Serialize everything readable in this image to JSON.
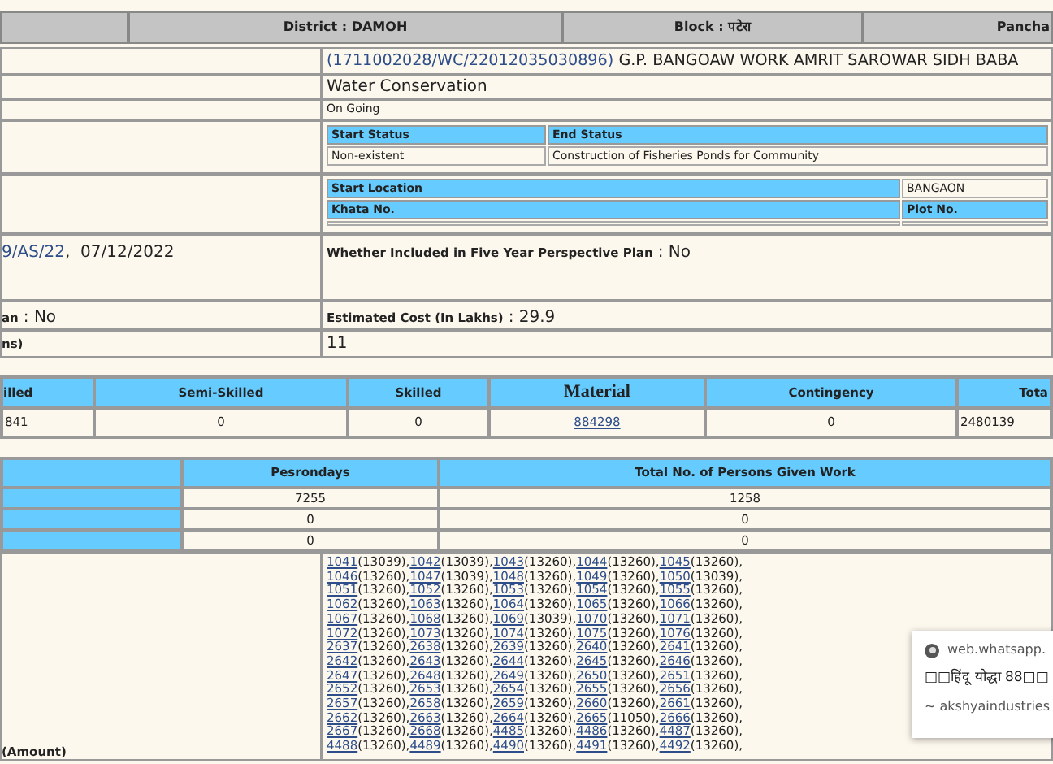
{
  "header": {
    "district": "District : DAMOH",
    "block": "Block : पटेरा",
    "panchayat": "Pancha"
  },
  "work": {
    "code": "(1711002028/WC/22012035030896)",
    "name": "G.P. BANGOAW WORK AMRIT SAROWAR SIDH BABA",
    "category": "Water Conservation",
    "status": "On Going"
  },
  "status_table": {
    "columns": [
      "Start Status",
      "End Status"
    ],
    "row": [
      "Non-existent",
      "Construction of Fisheries Ponds for Community"
    ]
  },
  "location_table": {
    "rows": [
      [
        {
          "text": "Start Location",
          "kind": "header"
        },
        {
          "text": "BANGAON",
          "kind": "cell"
        }
      ],
      [
        {
          "text": "Khata No.",
          "kind": "header"
        },
        {
          "text": "Plot No.",
          "kind": "header"
        }
      ]
    ]
  },
  "sanction": {
    "order": "9/AS/22",
    "date": ",  07/12/2022"
  },
  "perspective_plan": {
    "label": "Whether Included in Five Year Perspective Plan",
    "value": ": No"
  },
  "plan_field": {
    "label": "an",
    "value": ": No"
  },
  "estimated_cost": {
    "label": "Estimated Cost (In Lakhs)",
    "value": ": 29.9"
  },
  "count_field": {
    "label": "ns)",
    "value": "11"
  },
  "cost_table": {
    "columns": [
      {
        "label": "illed",
        "kind": "plain"
      },
      {
        "label": "Semi-Skilled",
        "kind": "plain"
      },
      {
        "label": "Skilled",
        "kind": "plain"
      },
      {
        "label": "Material",
        "kind": "large"
      },
      {
        "label": "Contingency",
        "kind": "plain"
      },
      {
        "label": "Tota",
        "kind": "plain"
      }
    ],
    "row": [
      {
        "text": "841",
        "kind": "text"
      },
      {
        "text": "0",
        "kind": "number"
      },
      {
        "text": "0",
        "kind": "number"
      },
      {
        "text": "884298",
        "kind": "link"
      },
      {
        "text": "0",
        "kind": "number"
      },
      {
        "text": "2480139",
        "kind": "text"
      }
    ]
  },
  "persondays_table": {
    "columns": [
      "Pesrondays",
      "Total No. of Persons Given Work"
    ],
    "rows": [
      [
        "7255",
        "1258"
      ],
      [
        "0",
        "0"
      ],
      [
        "0",
        "0"
      ]
    ]
  },
  "amount": {
    "label": "(Amount)",
    "work_codes": [
      [
        [
          "1041",
          "(13039),"
        ],
        [
          "1042",
          "(13039),"
        ],
        [
          "1043",
          "(13260),"
        ],
        [
          "1044",
          "(13260),"
        ],
        [
          "1045",
          "(13260),"
        ]
      ],
      [
        [
          "1046",
          "(13260),"
        ],
        [
          "1047",
          "(13039),"
        ],
        [
          "1048",
          "(13260),"
        ],
        [
          "1049",
          "(13260),"
        ],
        [
          "1050",
          "(13039),"
        ]
      ],
      [
        [
          "1051",
          "(13260),"
        ],
        [
          "1052",
          "(13260),"
        ],
        [
          "1053",
          "(13260),"
        ],
        [
          "1054",
          "(13260),"
        ],
        [
          "1055",
          "(13260),"
        ]
      ],
      [
        [
          "1062",
          "(13260),"
        ],
        [
          "1063",
          "(13260),"
        ],
        [
          "1064",
          "(13260),"
        ],
        [
          "1065",
          "(13260),"
        ],
        [
          "1066",
          "(13260),"
        ]
      ],
      [
        [
          "1067",
          "(13260),"
        ],
        [
          "1068",
          "(13260),"
        ],
        [
          "1069",
          "(13039),"
        ],
        [
          "1070",
          "(13260),"
        ],
        [
          "1071",
          "(13260),"
        ]
      ],
      [
        [
          "1072",
          "(13260),"
        ],
        [
          "1073",
          "(13260),"
        ],
        [
          "1074",
          "(13260),"
        ],
        [
          "1075",
          "(13260),"
        ],
        [
          "1076",
          "(13260),"
        ]
      ],
      [
        [
          "2637",
          "(13260),"
        ],
        [
          "2638",
          "(13260),"
        ],
        [
          "2639",
          "(13260),"
        ],
        [
          "2640",
          "(13260),"
        ],
        [
          "2641",
          "(13260),"
        ]
      ],
      [
        [
          "2642",
          "(13260),"
        ],
        [
          "2643",
          "(13260),"
        ],
        [
          "2644",
          "(13260),"
        ],
        [
          "2645",
          "(13260),"
        ],
        [
          "2646",
          "(13260),"
        ]
      ],
      [
        [
          "2647",
          "(13260),"
        ],
        [
          "2648",
          "(13260),"
        ],
        [
          "2649",
          "(13260),"
        ],
        [
          "2650",
          "(13260),"
        ],
        [
          "2651",
          "(13260),"
        ]
      ],
      [
        [
          "2652",
          "(13260),"
        ],
        [
          "2653",
          "(13260),"
        ],
        [
          "2654",
          "(13260),"
        ],
        [
          "2655",
          "(13260),"
        ],
        [
          "2656",
          "(13260),"
        ]
      ],
      [
        [
          "2657",
          "(13260),"
        ],
        [
          "2658",
          "(13260),"
        ],
        [
          "2659",
          "(13260),"
        ],
        [
          "2660",
          "(13260),"
        ],
        [
          "2661",
          "(13260),"
        ]
      ],
      [
        [
          "2662",
          "(13260),"
        ],
        [
          "2663",
          "(13260),"
        ],
        [
          "2664",
          "(13260),"
        ],
        [
          "2665",
          "(11050),"
        ],
        [
          "2666",
          "(13260),"
        ]
      ],
      [
        [
          "2667",
          "(13260),"
        ],
        [
          "2668",
          "(13260),"
        ],
        [
          "4485",
          "(13260),"
        ],
        [
          "4486",
          "(13260),"
        ],
        [
          "4487",
          "(13260),"
        ]
      ],
      [
        [
          "4488",
          "(13260),"
        ],
        [
          "4489",
          "(13260),"
        ],
        [
          "4490",
          "(13260),"
        ],
        [
          "4491",
          "(13260),"
        ],
        [
          "4492",
          "(13260),"
        ]
      ]
    ]
  },
  "notification": {
    "source": "web.whatsapp.",
    "title": "□□हिंदू योद्धा 88□□",
    "sender": "~ akshyaindustries"
  }
}
